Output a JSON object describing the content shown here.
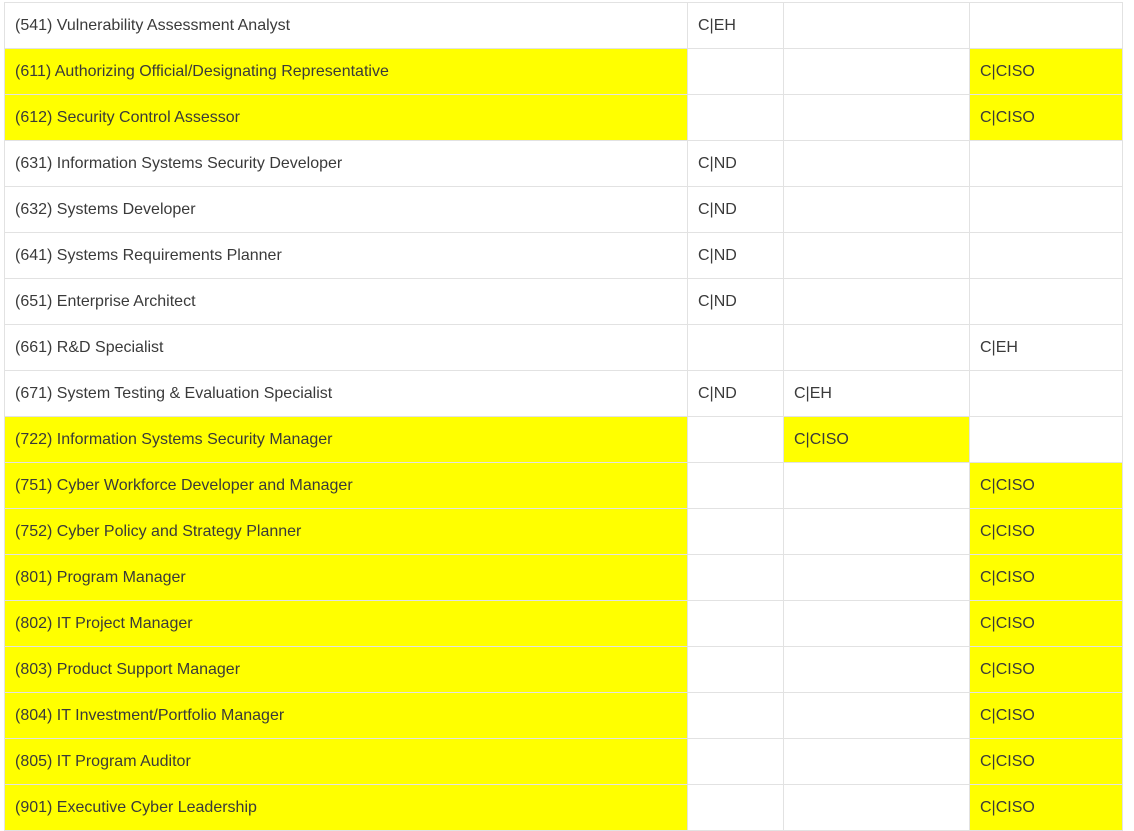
{
  "highlight_color": "#ffff00",
  "table": {
    "rows": [
      {
        "role": "(541) Vulnerability Assessment Analyst",
        "c1": "C|EH",
        "c2": "",
        "c3": "",
        "hl": [
          false,
          false,
          false,
          false
        ]
      },
      {
        "role": "(611) Authorizing Official/Designating Representative",
        "c1": "",
        "c2": "",
        "c3": "C|CISO",
        "hl": [
          true,
          false,
          false,
          true
        ]
      },
      {
        "role": "(612) Security Control Assessor",
        "c1": "",
        "c2": "",
        "c3": "C|CISO",
        "hl": [
          true,
          false,
          false,
          true
        ]
      },
      {
        "role": "(631) Information Systems Security Developer",
        "c1": "C|ND",
        "c2": "",
        "c3": "",
        "hl": [
          false,
          false,
          false,
          false
        ]
      },
      {
        "role": "(632) Systems Developer",
        "c1": "C|ND",
        "c2": "",
        "c3": "",
        "hl": [
          false,
          false,
          false,
          false
        ]
      },
      {
        "role": "(641) Systems Requirements Planner",
        "c1": "C|ND",
        "c2": "",
        "c3": "",
        "hl": [
          false,
          false,
          false,
          false
        ]
      },
      {
        "role": "(651) Enterprise Architect",
        "c1": "C|ND",
        "c2": "",
        "c3": "",
        "hl": [
          false,
          false,
          false,
          false
        ]
      },
      {
        "role": "(661) R&D Specialist",
        "c1": "",
        "c2": "",
        "c3": "C|EH",
        "hl": [
          false,
          false,
          false,
          false
        ]
      },
      {
        "role": "(671) System Testing & Evaluation Specialist",
        "c1": "C|ND",
        "c2": "C|EH",
        "c3": "",
        "hl": [
          false,
          false,
          false,
          false
        ]
      },
      {
        "role": "(722) Information Systems Security Manager",
        "c1": "",
        "c2": "C|CISO",
        "c3": "",
        "hl": [
          true,
          false,
          true,
          false
        ]
      },
      {
        "role": "(751) Cyber Workforce Developer and Manager",
        "c1": "",
        "c2": "",
        "c3": "C|CISO",
        "hl": [
          true,
          false,
          false,
          true
        ]
      },
      {
        "role": "(752) Cyber Policy and Strategy Planner",
        "c1": "",
        "c2": "",
        "c3": "C|CISO",
        "hl": [
          true,
          false,
          false,
          true
        ]
      },
      {
        "role": "(801) Program Manager",
        "c1": "",
        "c2": "",
        "c3": "C|CISO",
        "hl": [
          true,
          false,
          false,
          true
        ]
      },
      {
        "role": "(802) IT Project Manager",
        "c1": "",
        "c2": "",
        "c3": "C|CISO",
        "hl": [
          true,
          false,
          false,
          true
        ]
      },
      {
        "role": "(803) Product Support Manager",
        "c1": "",
        "c2": "",
        "c3": "C|CISO",
        "hl": [
          true,
          false,
          false,
          true
        ]
      },
      {
        "role": "(804) IT Investment/Portfolio Manager",
        "c1": "",
        "c2": "",
        "c3": "C|CISO",
        "hl": [
          true,
          false,
          false,
          true
        ]
      },
      {
        "role": "(805) IT Program Auditor",
        "c1": "",
        "c2": "",
        "c3": "C|CISO",
        "hl": [
          true,
          false,
          false,
          true
        ]
      },
      {
        "role": "(901) Executive Cyber Leadership",
        "c1": "",
        "c2": "",
        "c3": "C|CISO",
        "hl": [
          true,
          false,
          false,
          true
        ]
      }
    ]
  }
}
